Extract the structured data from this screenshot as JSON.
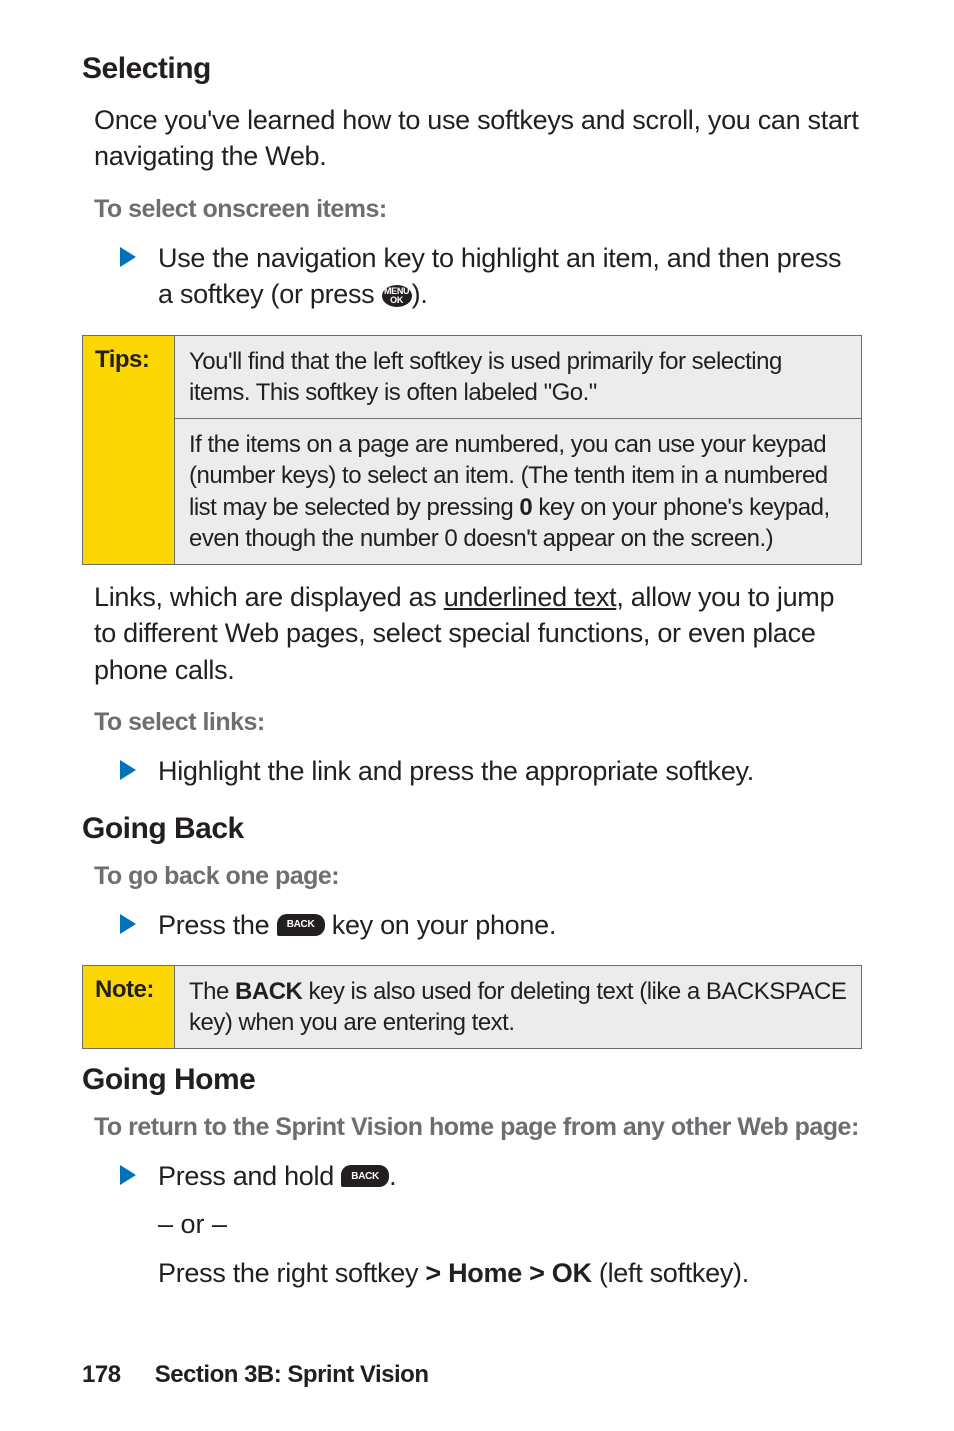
{
  "h_selecting": "Selecting",
  "p_selecting_intro": "Once you've learned how to use softkeys and scroll, you can start navigating the Web.",
  "lbl_select_onscreen": "To select onscreen items:",
  "bullet_use_nav_a": "Use the navigation key to highlight an item, and then press a softkey (or press ",
  "bullet_use_nav_b": ").",
  "tips_label": "Tips:",
  "tip1": "You'll find that the left softkey is used primarily for selecting items. This softkey is often labeled \"Go.\"",
  "tip2_a": "If the items on a page are numbered, you can use your keypad (number keys) to select an item. (The tenth item in a numbered list may be selected by pressing ",
  "tip2_bold": "0",
  "tip2_b": " key on your phone's keypad, even though the number 0 doesn't appear on the screen.)",
  "p_links_a": "Links, which are displayed as ",
  "p_links_underlined": "underlined text",
  "p_links_b": ", allow you to jump to different Web pages, select special functions, or even place phone calls.",
  "lbl_select_links": "To select links:",
  "bullet_highlight": "Highlight the link and press the appropriate softkey.",
  "h_going_back": "Going Back",
  "lbl_go_back": "To go back one page:",
  "bullet_press_back_a": "Press the ",
  "bullet_press_back_b": " key on your phone.",
  "note_label": "Note:",
  "note_a": "The ",
  "note_bold": "BACK",
  "note_b": " key is also used for deleting text (like a BACKSPACE key) when you are entering text.",
  "h_going_home": "Going Home",
  "lbl_return_home": "To return to the Sprint Vision home page from any other Web page:",
  "bullet_press_hold_a": "Press and hold ",
  "bullet_press_hold_b": ".",
  "or_text": "– or –",
  "press_right_a": "Press the right softkey ",
  "press_right_bold1": "> Home > OK",
  "press_right_b": " (left softkey).",
  "footer_page": "178",
  "footer_section": "Section 3B: Sprint Vision",
  "menu_icon_text": "MENU",
  "menu_icon_sub": "OK",
  "back_icon_text": "BACK"
}
